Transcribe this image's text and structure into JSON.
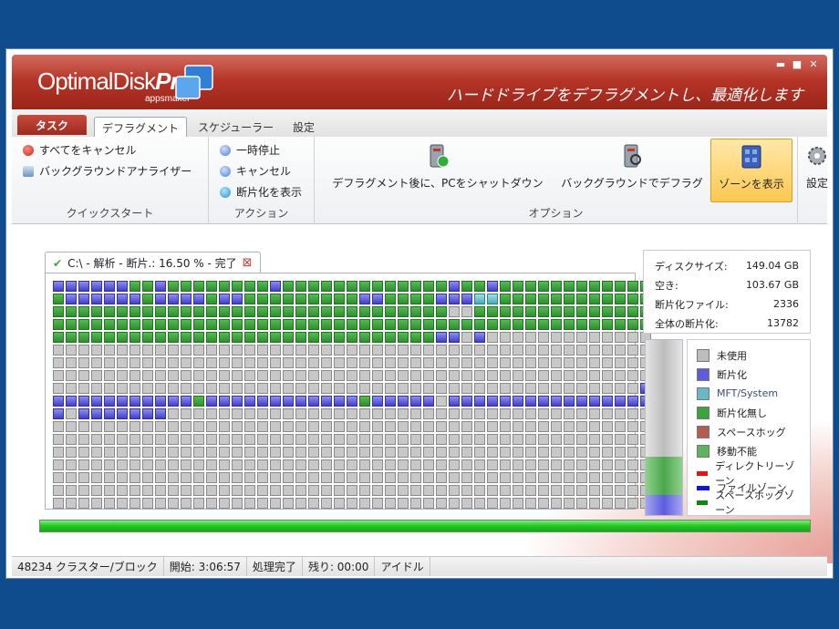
{
  "app": {
    "logo_main": "OptimalDisk",
    "logo_bold": "Pro",
    "logo_sub": "appsmaker",
    "tagline": "ハードドライブをデフラグメントし、最適化します",
    "window_buttons": {
      "minimize": "▬",
      "maximize": "■",
      "close": "✕"
    }
  },
  "tabs": [
    {
      "label": "タスク",
      "active": false
    },
    {
      "label": "デフラグメント",
      "active": true
    },
    {
      "label": "スケジューラー",
      "active": false
    },
    {
      "label": "設定",
      "active": false
    }
  ],
  "ribbon": {
    "quickstart": {
      "label": "クイックスタート",
      "items": [
        "すべてをキャンセル",
        "バックグラウンドアナライザー"
      ]
    },
    "action": {
      "label": "アクション",
      "items": [
        "一時停止",
        "キャンセル",
        "断片化を表示"
      ]
    },
    "options": {
      "label": "オプション",
      "buttons": [
        "デフラグメント後に、PCをシャットダウン",
        "バックグラウンドでデフラグ",
        "ゾーンを表示"
      ]
    },
    "settings_partial": "設定"
  },
  "map": {
    "tab_label": "C:\\ - 解析 - 断片.: 16.50 % - 完了",
    "tab_close": "⊠",
    "rows": [
      "ffffffggfggggggggfgggggggggggggfggfgggggggggggg",
      "gffffffgffffgffgggggggggffggggfffmmgggggggggggg",
      "gggggggggggggggggggggggggggggggeegggggggggggggg",
      "ggggggggggggggggggggggggggggggggggggggggggggggg",
      "ggggggggggggggggggggggggggggggffefeeeeeeeeeeeee",
      "eeeeeeeeeeeeeeeeeeeeeeeeeeeeeeeeeeeeeeeeeeeeeee",
      "eeeeeeeeeeeeeeeeeeeeeeeeeeeeeeeeeeeeeeeeeeeeeee",
      "eeeeeeeeeeeeeeeeeeeeeeeeeeeeeeeeeeeeeeeeeeeeeee",
      "eeeeeeeeeeeeeeeeeeeeeeeeeeeeeeeeeeeeeeeeeeeeeef",
      "fffffffffffgffffffffffffgfffffeffffffffffffffff",
      "fefffffffeeeeeeeeeeeeeeeeeeeeeeeeeeeeeeeeeeeeee",
      "eeeeeeeeeeeeeeeeeeeeeeeeeeeeeeeeeeeeeeeeeeeeeee",
      "eeeeeeeeeeeeeeeeeeeeeeeeeeeeeeeeeeeeeeeeeeeeeee",
      "eeeeeeeeeeeeeeeeeeeeeeeeeeeeeeeeeeeeeeeeeeeeeee",
      "eeeeeeeeeeeeeeeeeeeeeeeeeeeeeeeeeeeeeeeeeeeeeee",
      "eeeeeeeeeeeeeeeeeeeeeeeeeeeeeeeeeeeeeeeeeeeeeee",
      "eeeeeeeeeeeeeeeeeeeeeeeeeeeeeeeeeeeeeeeeeeeeeee",
      "eeeeeeeeeeeeeeeeeeeeeeeeeeeeeeeeeeeeeeeeeeeeeee"
    ]
  },
  "stats": [
    {
      "label": "ディスクサイズ:",
      "value": "149.04 GB"
    },
    {
      "label": "空き:",
      "value": "103.67 GB"
    },
    {
      "label": "断片化ファイル:",
      "value": "2336"
    },
    {
      "label": "全体の断片化:",
      "value": "13782"
    }
  ],
  "legend": [
    {
      "label": "未使用",
      "color": "#bdbdbd"
    },
    {
      "label": "断片化",
      "color": "#5c5cdc"
    },
    {
      "label": "MFT/System",
      "color": "#67b9c7"
    },
    {
      "label": "断片化無し",
      "color": "#3aa63a"
    },
    {
      "label": "スペースホッグ",
      "color": "#b75a52"
    },
    {
      "label": "移動不能",
      "color": "#5eb35e"
    }
  ],
  "zones": [
    {
      "label": "ディレクトリーゾーン",
      "color": "#e81010"
    },
    {
      "label": "ファイルゾーン",
      "color": "#1010e8"
    },
    {
      "label": "スペースホッグゾーン",
      "color": "#0d8a0d"
    }
  ],
  "progress_percent": 100,
  "status": {
    "clusters": "48234 クラスター/ブロック",
    "start": "開始: 3:06:57",
    "state": "処理完了",
    "remaining": "残り: 00:00",
    "mode": "アイドル"
  }
}
